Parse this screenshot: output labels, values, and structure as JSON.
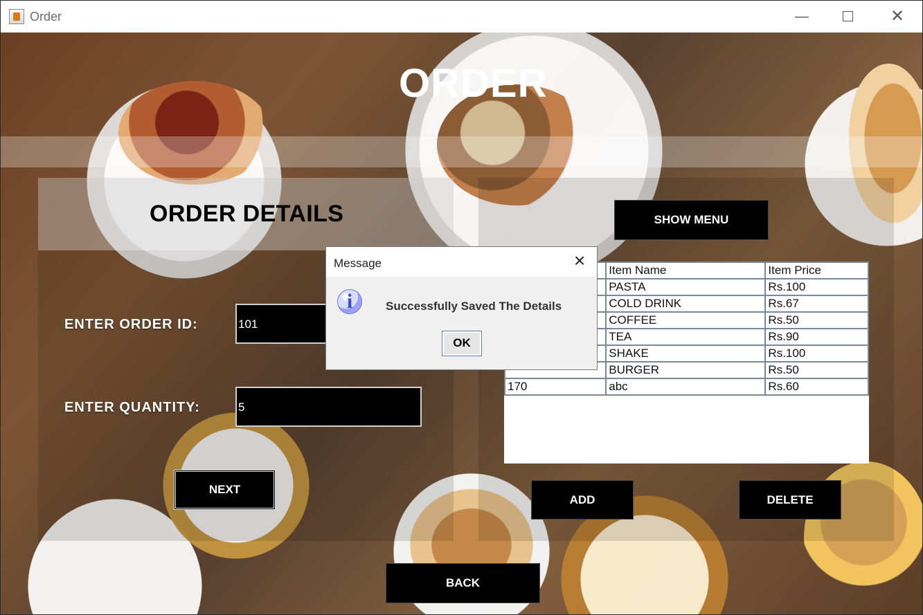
{
  "window": {
    "title": "Order",
    "app_icon": "java-coffee-cup-icon",
    "controls": {
      "minimize": "—",
      "close": "✕"
    }
  },
  "page": {
    "heading": "ORDER",
    "section_title": "ORDER DETAILS",
    "buttons": {
      "show_menu": "SHOW MENU",
      "next": "NEXT",
      "add": "ADD",
      "delete": "DELETE",
      "back": "BACK"
    }
  },
  "form": {
    "order_id_label": "ENTER ORDER ID:",
    "order_id_value": "101",
    "quantity_label": "ENTER QUANTITY:",
    "quantity_value": "5"
  },
  "menu_table": {
    "headers": [
      "Item Name",
      "Item Price"
    ],
    "rows": [
      {
        "id": "",
        "name": "PASTA",
        "price": "Rs.100"
      },
      {
        "id": "",
        "name": "COLD DRINK",
        "price": "Rs.67"
      },
      {
        "id": "",
        "name": "COFFEE",
        "price": "Rs.50"
      },
      {
        "id": "",
        "name": "TEA",
        "price": "Rs.90"
      },
      {
        "id": "",
        "name": "SHAKE",
        "price": "Rs.100"
      },
      {
        "id": "",
        "name": "BURGER",
        "price": "Rs.50"
      },
      {
        "id": "170",
        "name": "abc",
        "price": "Rs.60"
      }
    ]
  },
  "dialog": {
    "title": "Message",
    "message": "Successfully Saved The Details",
    "ok_label": "OK",
    "icon": "info-icon"
  }
}
